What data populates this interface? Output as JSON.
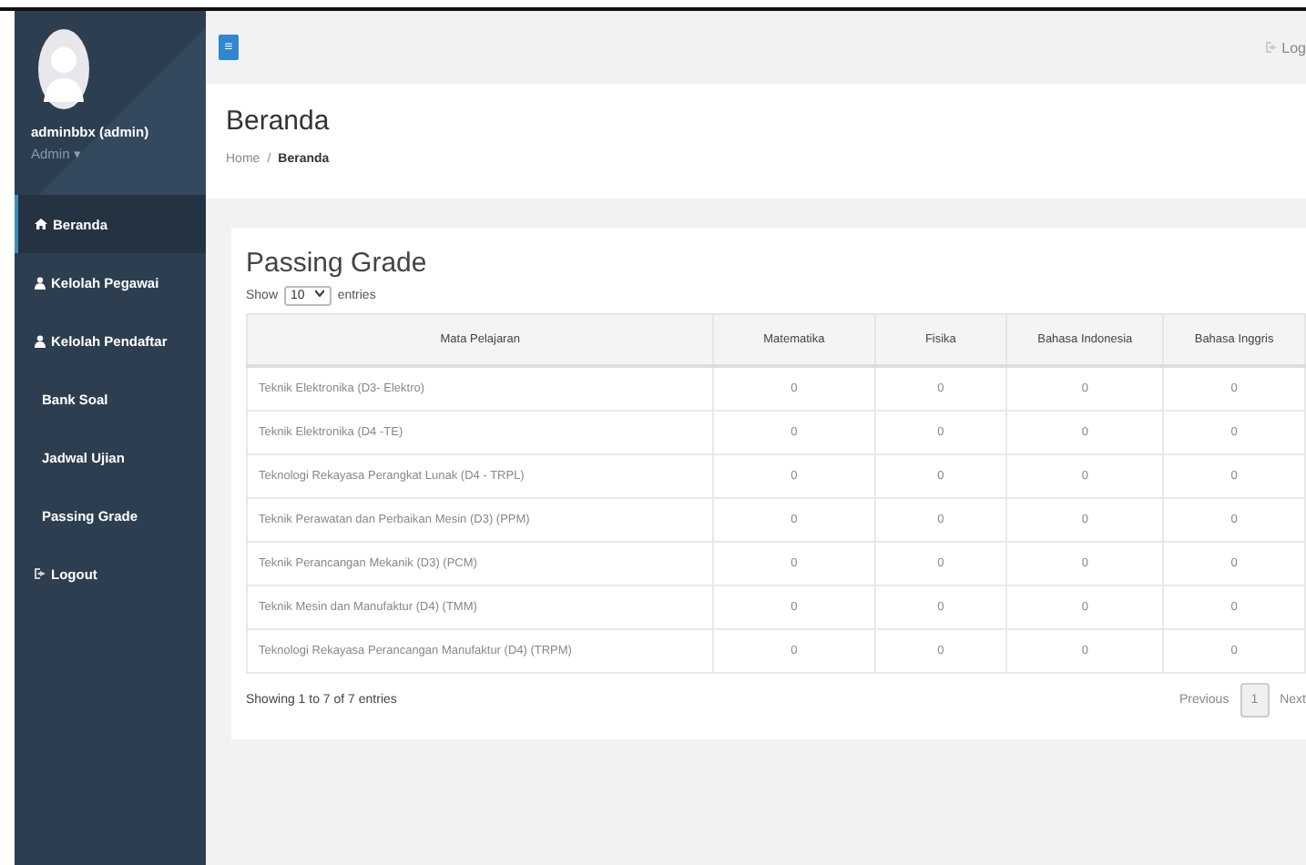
{
  "sidebar": {
    "user": {
      "name": "adminbbx (admin)",
      "role": "Admin",
      "role_caret": "▾"
    },
    "items": [
      {
        "label": "Beranda",
        "kind": "home",
        "selected": true
      },
      {
        "label": "Kelolah Pegawai",
        "kind": "user",
        "selected": false
      },
      {
        "label": "Kelolah Pendaftar",
        "kind": "user",
        "selected": false
      },
      {
        "label": "Bank Soal",
        "kind": "plain",
        "selected": false
      },
      {
        "label": "Jadwal Ujian",
        "kind": "plain",
        "selected": false
      },
      {
        "label": "Passing Grade",
        "kind": "plain",
        "selected": false
      },
      {
        "label": "Logout",
        "kind": "logout",
        "selected": false
      }
    ]
  },
  "topbar": {
    "menu_glyph": "≡",
    "logout": "Log"
  },
  "header": {
    "title": "Beranda",
    "breadcrumb": [
      "Home",
      "Beranda"
    ],
    "separator": "/"
  },
  "card": {
    "title": "Passing Grade",
    "length": {
      "prefix": "Show",
      "value": "10",
      "suffix": "entries"
    },
    "table": {
      "columns": [
        "Mata Pelajaran",
        "Matematika",
        "Fisika",
        "Bahasa Indonesia",
        "Bahasa Inggris"
      ],
      "rows": [
        [
          "Teknik Elektronika (D3- Elektro)",
          "0",
          "0",
          "0",
          "0"
        ],
        [
          "Teknik Elektronika (D4 -TE)",
          "0",
          "0",
          "0",
          "0"
        ],
        [
          "Teknologi Rekayasa Perangkat Lunak (D4 - TRPL)",
          "0",
          "0",
          "0",
          "0"
        ],
        [
          "Teknik Perawatan dan Perbaikan Mesin (D3) (PPM)",
          "0",
          "0",
          "0",
          "0"
        ],
        [
          "Teknik Perancangan Mekanik (D3) (PCM)",
          "0",
          "0",
          "0",
          "0"
        ],
        [
          "Teknik Mesin dan Manufaktur (D4) (TMM)",
          "0",
          "0",
          "0",
          "0"
        ],
        [
          "Teknologi Rekayasa Perancangan Manufaktur (D4) (TRPM)",
          "0",
          "0",
          "0",
          "0"
        ]
      ]
    },
    "info": "Showing 1 to 7 of 7 entries",
    "pagination": [
      {
        "label": "Previous",
        "selected": false
      },
      {
        "label": "1",
        "selected": true
      },
      {
        "label": "Next",
        "selected": false
      }
    ]
  }
}
